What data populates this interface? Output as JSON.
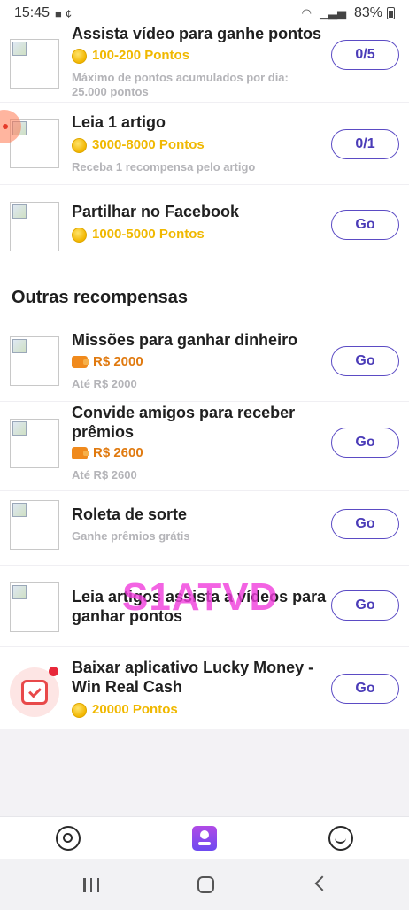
{
  "status_bar": {
    "time": "15:45",
    "battery": "83%"
  },
  "tasks_top": [
    {
      "title": "Assista vídeo para ganhe pontos",
      "reward": "100-200 Pontos",
      "desc": "Máximo de pontos acumulados por dia: 25.000 pontos",
      "button": "0/5"
    },
    {
      "title": "Leia 1 artigo",
      "reward": "3000-8000 Pontos",
      "desc": "Receba 1 recompensa pelo artigo",
      "button": "0/1"
    },
    {
      "title": "Partilhar no Facebook",
      "reward": "1000-5000 Pontos",
      "button": "Go"
    }
  ],
  "section_title": "Outras recompensas",
  "tasks_other": [
    {
      "title": "Missões para ganhar dinheiro",
      "reward": "R$ 2000",
      "desc": "Até R$ 2000",
      "button": "Go"
    },
    {
      "title": "Convide amigos para receber prêmios",
      "reward": "R$ 2600",
      "desc": "Até R$ 2600",
      "button": "Go"
    },
    {
      "title": "Roleta de sorte",
      "desc": "Ganhe prêmios grátis",
      "button": "Go"
    },
    {
      "title": "Leia artigos assista a vídeos para ganhar pontos",
      "button": "Go"
    },
    {
      "title": "Baixar aplicativo Lucky Money - Win Real Cash",
      "reward": "20000 Pontos",
      "button": "Go"
    }
  ],
  "watermark": "S1ATVD",
  "tabs": [
    {
      "name": "explore",
      "icon": "compass-icon"
    },
    {
      "name": "tasks",
      "icon": "tasks-icon",
      "active": true
    },
    {
      "name": "profile",
      "icon": "smiley-icon"
    }
  ],
  "colors": {
    "accent": "#5b4bc4",
    "coin": "#f0b800",
    "cash": "#e07a10"
  }
}
